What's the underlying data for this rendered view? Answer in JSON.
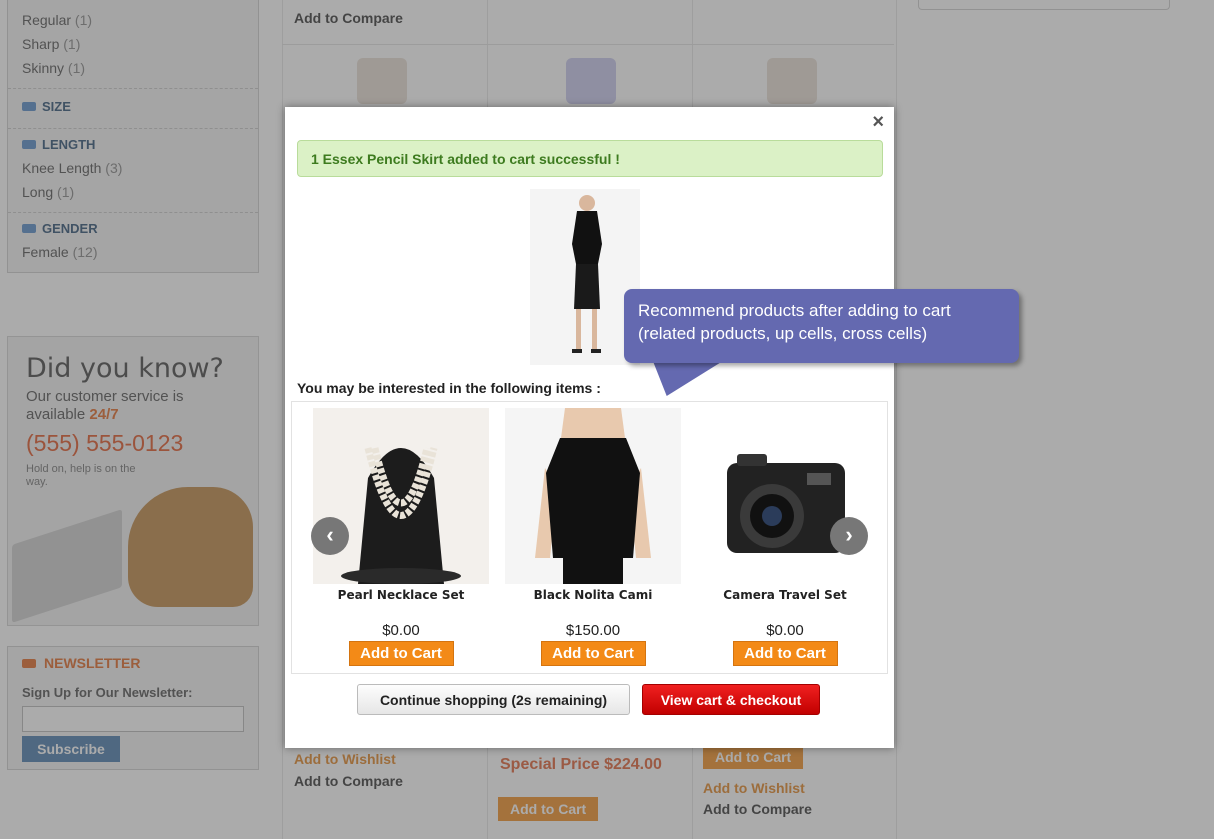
{
  "sidebar": {
    "filters_top": [
      {
        "label": "Regular",
        "count": "(1)"
      },
      {
        "label": "Sharp",
        "count": "(1)"
      },
      {
        "label": "Skinny",
        "count": "(1)"
      }
    ],
    "size_title": "SIZE",
    "length_title": "LENGTH",
    "length_items": [
      {
        "label": "Knee Length",
        "count": "(3)"
      },
      {
        "label": "Long",
        "count": "(1)"
      }
    ],
    "gender_title": "GENDER",
    "gender_items": [
      {
        "label": "Female",
        "count": "(12)"
      }
    ]
  },
  "didyouknow": {
    "title": "Did you know?",
    "text": "Our customer service is available",
    "highlight": "24/7",
    "phone": "(555) 555-0123",
    "small": "Hold on, help is on the way."
  },
  "newsletter": {
    "title": "NEWSLETTER",
    "label": "Sign Up for Our Newsletter:",
    "subscribe": "Subscribe"
  },
  "background_links": {
    "add_to_compare": "Add to Compare",
    "add_to_wishlist": "Add to Wishlist",
    "add_to_cart": "Add to Cart",
    "special_price": "Special Price $224.00"
  },
  "modal": {
    "close": "×",
    "success": "1 Essex Pencil Skirt added to cart successful !",
    "interested": "You may be interested in the following items :",
    "items": [
      {
        "name": "Pearl Necklace Set",
        "price": "$0.00",
        "button": "Add to Cart"
      },
      {
        "name": "Black Nolita Cami",
        "price": "$150.00",
        "button": "Add to Cart"
      },
      {
        "name": "Camera Travel Set",
        "price": "$0.00",
        "button": "Add to Cart"
      }
    ],
    "continue": "Continue shopping (2s remaining)",
    "checkout": "View cart & checkout"
  },
  "callout": {
    "line1": "Recommend products after adding to cart",
    "line2": "(related products, up cells, cross cells)"
  },
  "colors": {
    "accent_orange": "#f38a17",
    "checkout_red": "#d40000",
    "success_green": "#dbf1c6",
    "callout_purple": "#6469b0"
  }
}
